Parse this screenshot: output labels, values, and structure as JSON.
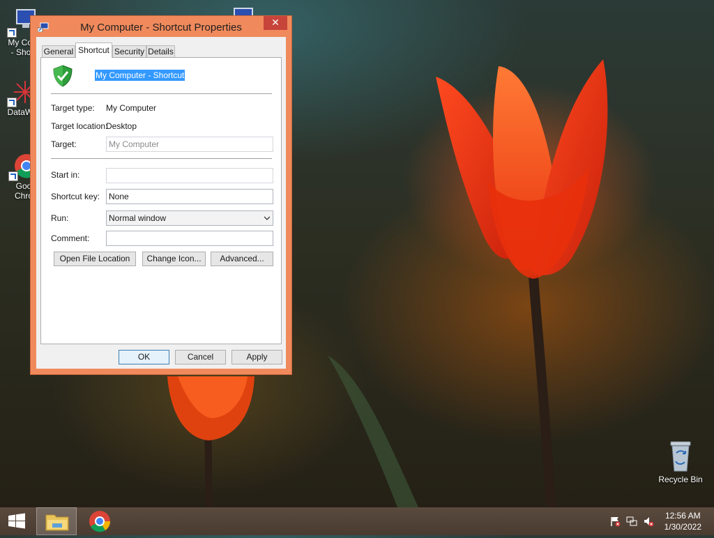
{
  "desktop": {
    "icons": [
      {
        "label_line1": "My Con",
        "label_line2": "- Shor",
        "icon": "computer-icon"
      },
      {
        "label_line1": "DataWa",
        "label_line2": "",
        "icon": "datawatch-icon"
      },
      {
        "label_line1": "Goo",
        "label_line2": "Chro",
        "icon": "chrome-icon"
      }
    ],
    "recycle_bin": {
      "label": "Recycle Bin",
      "icon": "recycle-bin-icon"
    }
  },
  "window": {
    "title": "My Computer - Shortcut Properties",
    "close_label": "✕",
    "tabs": [
      {
        "label": "General"
      },
      {
        "label": "Shortcut"
      },
      {
        "label": "Security"
      },
      {
        "label": "Details"
      }
    ],
    "shortcut_name": "My Computer - Shortcut",
    "target_type_label": "Target type:",
    "target_type_value": "My Computer",
    "target_location_label": "Target location:",
    "target_location_value": "Desktop",
    "target_label": "Target:",
    "target_value": "My Computer",
    "start_in_label": "Start in:",
    "start_in_value": "",
    "shortcut_key_label": "Shortcut key:",
    "shortcut_key_value": "None",
    "run_label": "Run:",
    "run_value": "Normal window",
    "comment_label": "Comment:",
    "comment_value": "",
    "open_file_location": "Open File Location",
    "change_icon": "Change Icon...",
    "advanced": "Advanced...",
    "ok": "OK",
    "cancel": "Cancel",
    "apply": "Apply"
  },
  "taskbar": {
    "time": "12:56 AM",
    "date": "1/30/2022"
  },
  "colors": {
    "title_bar": "#f08a5c",
    "close_button": "#c7443a",
    "selection": "#3399ff",
    "taskbar": "#4f4035"
  }
}
